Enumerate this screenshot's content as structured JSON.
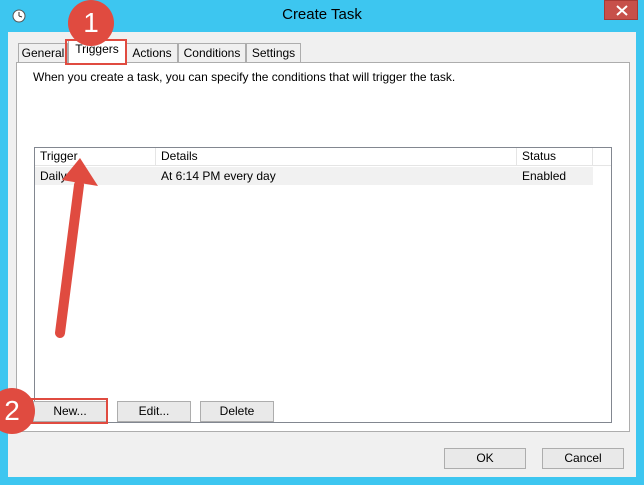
{
  "window": {
    "title": "Create Task"
  },
  "tabs": [
    {
      "label": "General"
    },
    {
      "label": "Triggers"
    },
    {
      "label": "Actions"
    },
    {
      "label": "Conditions"
    },
    {
      "label": "Settings"
    }
  ],
  "active_tab": "Triggers",
  "triggers": {
    "description": "When you create a task, you can specify the conditions that will trigger the task.",
    "columns": [
      "Trigger",
      "Details",
      "Status"
    ],
    "rows": [
      {
        "trigger": "Daily",
        "details": "At 6:14 PM every day",
        "status": "Enabled"
      }
    ],
    "new_label": "New...",
    "edit_label": "Edit...",
    "delete_label": "Delete"
  },
  "footer": {
    "ok_label": "OK",
    "cancel_label": "Cancel"
  },
  "annotations": {
    "step1": "1",
    "step2": "2",
    "color": "#e04b40"
  }
}
